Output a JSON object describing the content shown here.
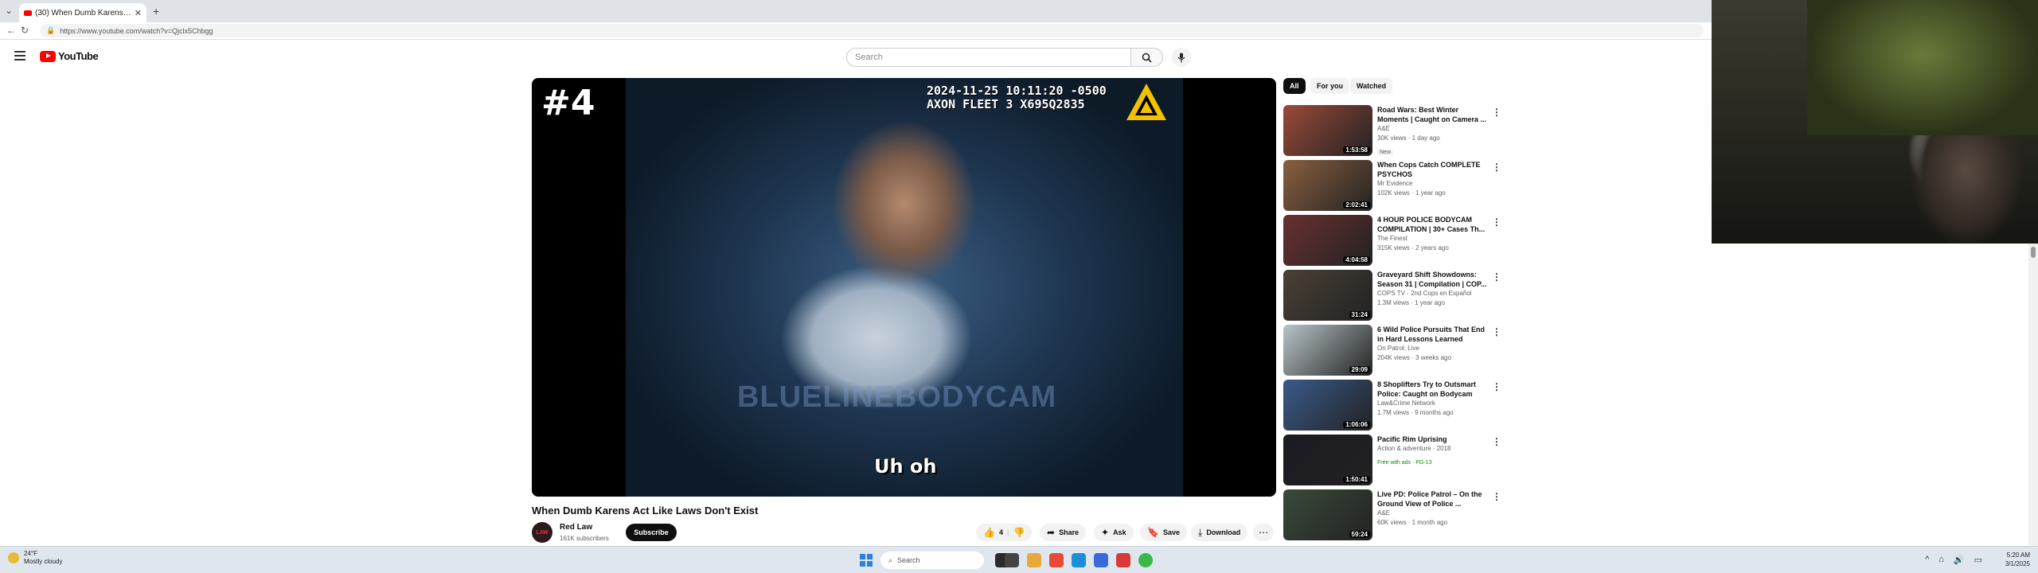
{
  "browser": {
    "tab_title": "(30) When Dumb Karens Act ...",
    "url": "https://www.youtube.com/watch?v=Qjclx5Chbgg"
  },
  "youtube": {
    "logo_text": "YouTube",
    "search_placeholder": "Search"
  },
  "player": {
    "rank_overlay": "#4",
    "timestamp_line1": "2024-11-25 10:11:20 -0500",
    "timestamp_line2": "AXON FLEET 3 X695Q2835",
    "watermark": "BLUELINEBODYCAM",
    "subtitle": "Uh oh"
  },
  "video": {
    "title": "When Dumb Karens Act Like Laws Don't Exist",
    "channel_name": "Red Law",
    "channel_avatar_text": "LAW",
    "subscribers": "161K subscribers",
    "subscribe_label": "Subscribe",
    "like_count": "4",
    "share_label": "Share",
    "ask_label": "Ask",
    "save_label": "Save",
    "download_label": "Download"
  },
  "chips": [
    "All",
    "For you",
    "Watched"
  ],
  "recommendations": [
    {
      "title": "Road Wars: Best Winter Moments | Caught on Camera ...",
      "channel": "A&E",
      "meta": "30K views · 1 day ago",
      "badge": "New",
      "duration": "1:53:58",
      "thumb": "#9a4a3a"
    },
    {
      "title": "When Cops Catch COMPLETE PSYCHOS",
      "channel": "Mr Evidence",
      "meta": "102K views · 1 year ago",
      "badge": "",
      "duration": "2:02:41",
      "thumb": "#8a6040"
    },
    {
      "title": "4 HOUR POLICE BODYCAM COMPILATION | 30+ Cases Th...",
      "channel": "The Finest",
      "meta": "315K views · 2 years ago",
      "badge": "",
      "duration": "4:04:58",
      "thumb": "#6a3030"
    },
    {
      "title": "Graveyard Shift Showdowns: Season 31 | Compilation | COP...",
      "channel": "COPS TV · 2nd Cops en Español",
      "meta": "1.3M views · 1 year ago",
      "badge": "",
      "duration": "31:24",
      "thumb": "#4a4036"
    },
    {
      "title": "6 Wild Police Pursuits That End in Hard Lessons Learned",
      "channel": "On Patrol: Live",
      "meta": "204K views · 3 weeks ago",
      "badge": "",
      "duration": "29:09",
      "thumb": "#b8c4c8"
    },
    {
      "title": "8 Shoplifters Try to Outsmart Police: Caught on Bodycam",
      "channel": "Law&Crime Network",
      "meta": "1.7M views · 9 months ago",
      "badge": "",
      "duration": "1:06:06",
      "thumb": "#3a5a8a"
    },
    {
      "title": "Pacific Rim Uprising",
      "channel": "Action & adventure · 2018",
      "meta": "",
      "badge": "Free with ads · PG-13",
      "duration": "1:50:41",
      "thumb": "#1a1a22"
    },
    {
      "title": "Live PD: Police Patrol – On the Ground View of Police ...",
      "channel": "A&E",
      "meta": "60K views · 1 month ago",
      "badge": "",
      "duration": "59:24",
      "thumb": "#3a4a3a"
    }
  ],
  "taskbar": {
    "weather_temp": "24°F",
    "weather_desc": "Mostly cloudy",
    "search_label": "Search",
    "time": "5:20 AM",
    "date": "3/1/2025"
  }
}
